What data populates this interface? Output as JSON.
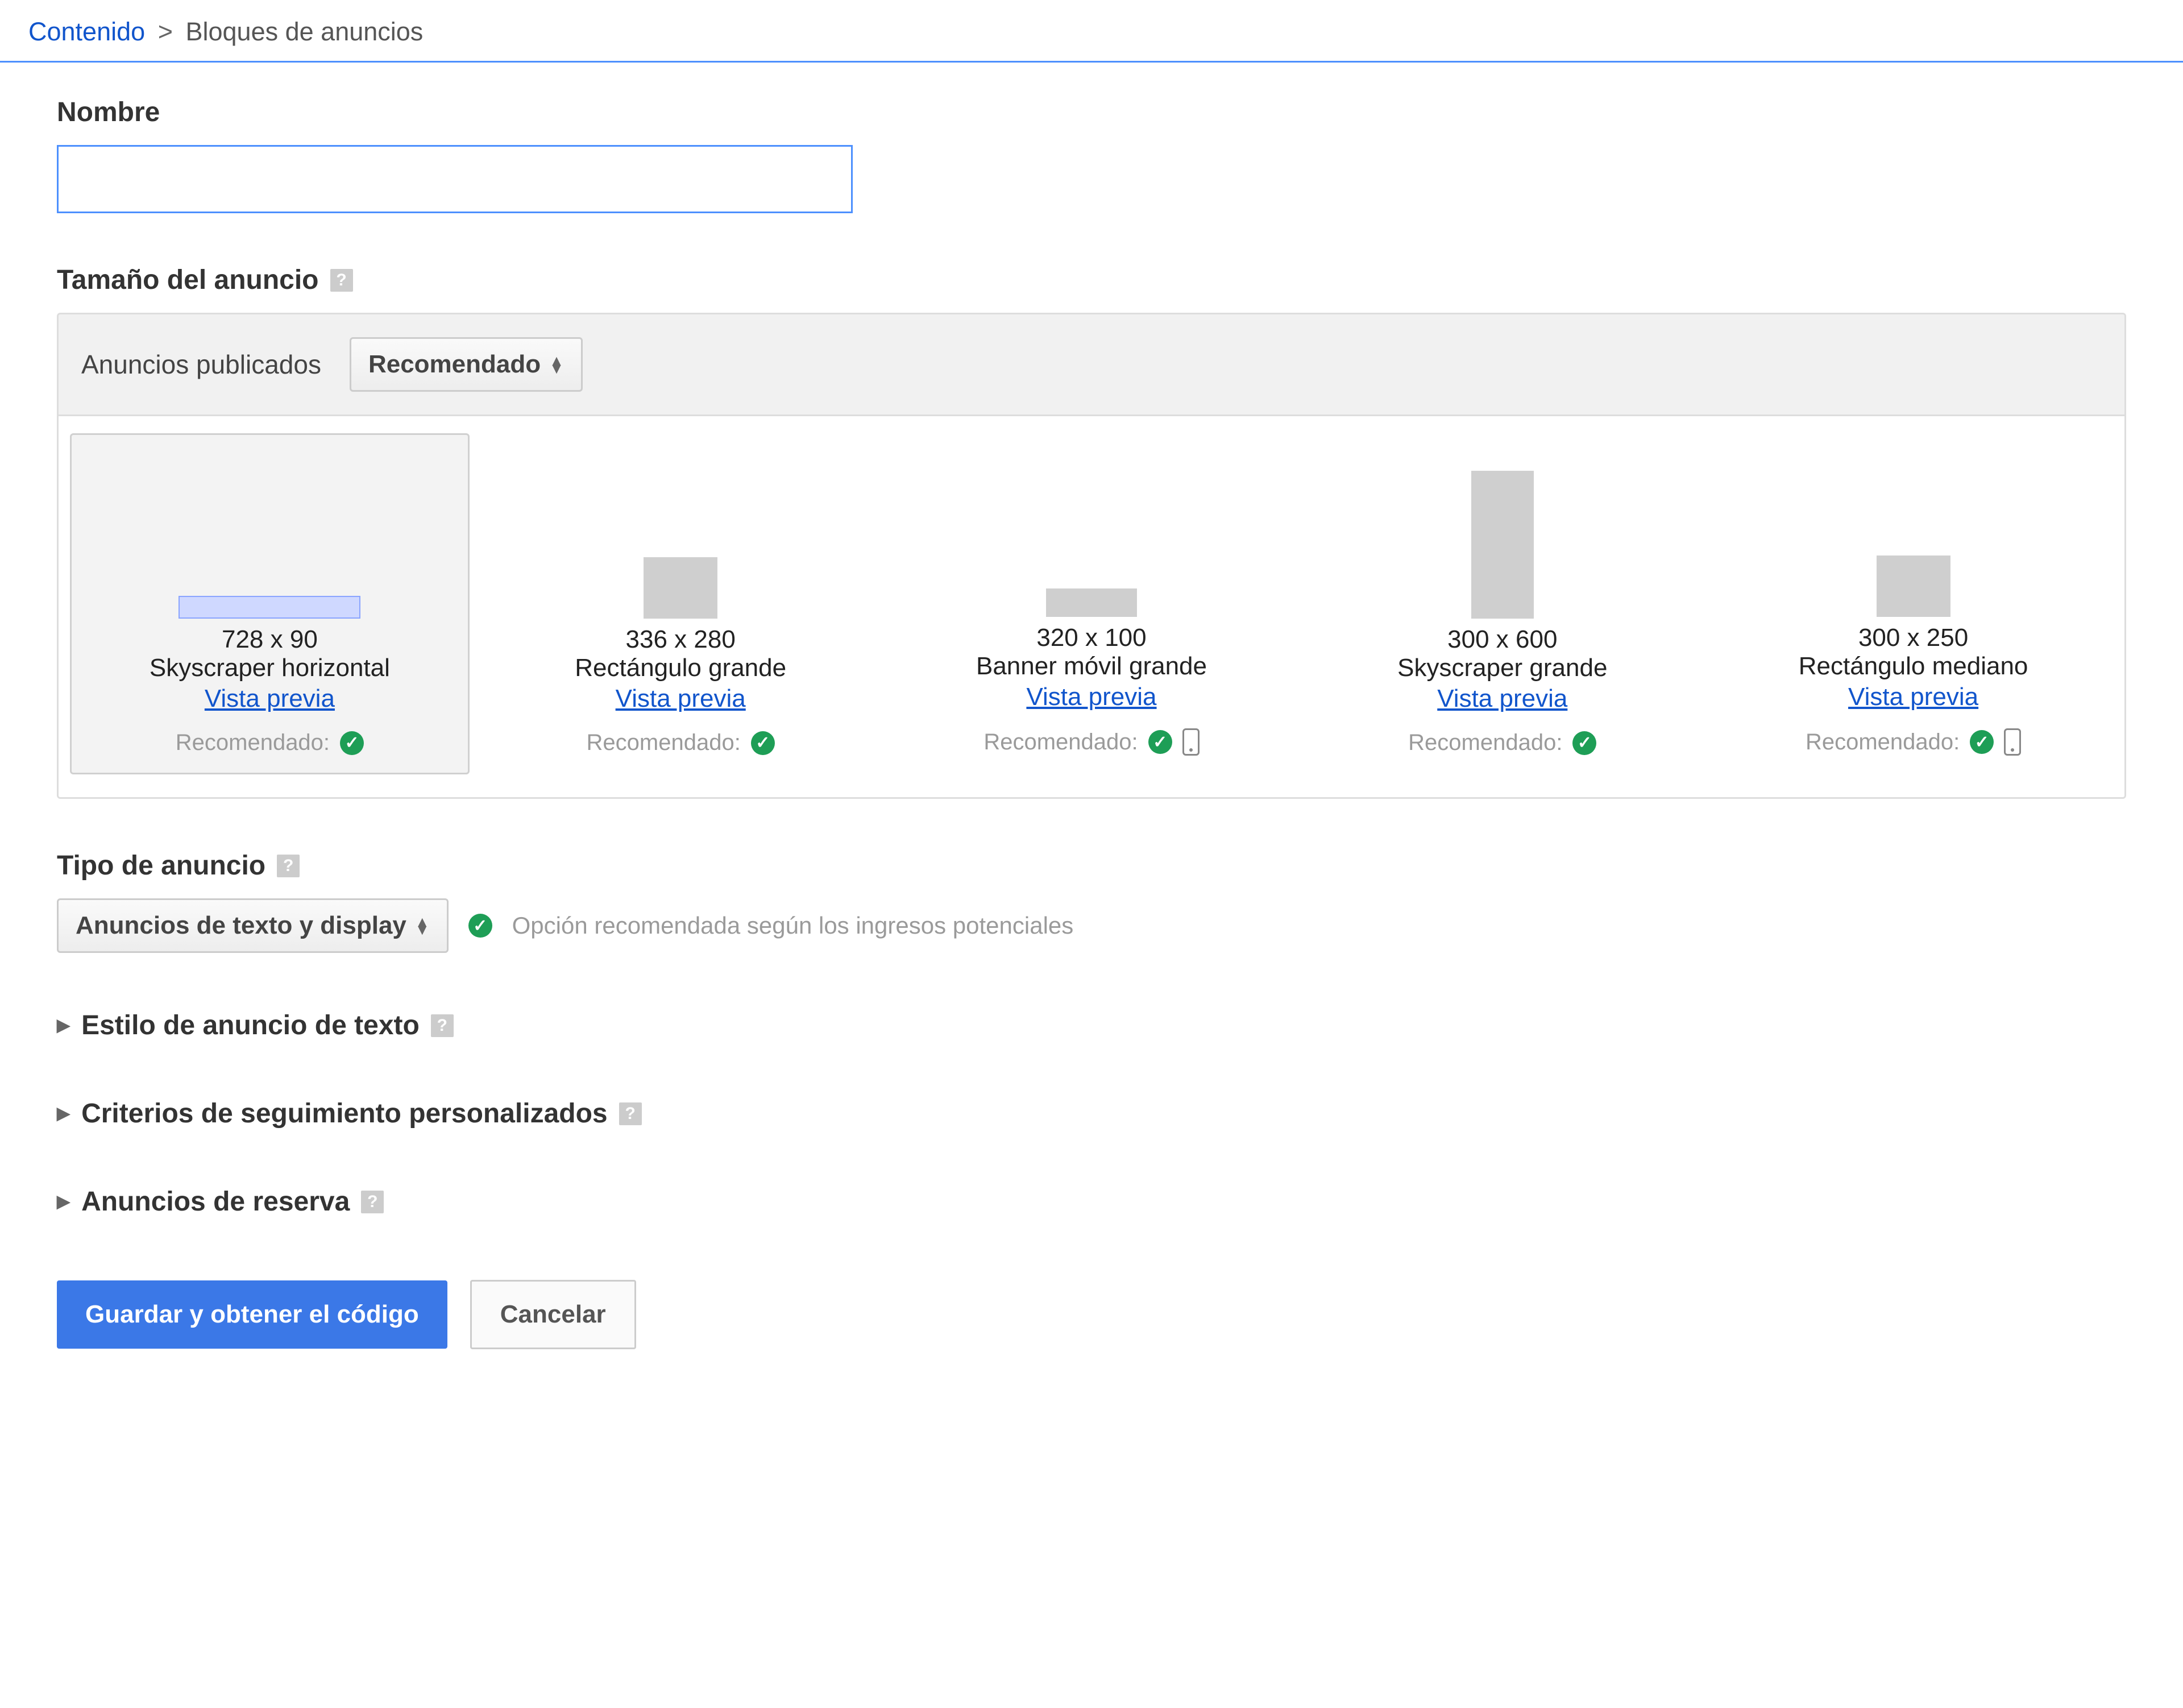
{
  "breadcrumb": {
    "root": "Contenido",
    "sep": ">",
    "current": "Bloques de anuncios"
  },
  "name": {
    "label": "Nombre",
    "value": ""
  },
  "adsize": {
    "label": "Tamaño del anuncio",
    "published_label": "Anuncios publicados",
    "filter_selected": "Recomendado",
    "preview_label": "Vista previa",
    "recommended_label": "Recomendado:",
    "cards": [
      {
        "dim": "728 x 90",
        "name": "Skyscraper horizontal",
        "selected": true,
        "mobile": false
      },
      {
        "dim": "336 x 280",
        "name": "Rectángulo grande",
        "selected": false,
        "mobile": false
      },
      {
        "dim": "320 x 100",
        "name": "Banner móvil grande",
        "selected": false,
        "mobile": true
      },
      {
        "dim": "300 x 600",
        "name": "Skyscraper grande",
        "selected": false,
        "mobile": false
      },
      {
        "dim": "300 x 250",
        "name": "Rectángulo mediano",
        "selected": false,
        "mobile": true
      }
    ]
  },
  "adtype": {
    "label": "Tipo de anuncio",
    "selected": "Anuncios de texto y display",
    "reco_note": "Opción recomendada según los ingresos potenciales"
  },
  "sections": {
    "text_style": "Estilo de anuncio de texto",
    "custom_tracking": "Criterios de seguimiento personalizados",
    "backup_ads": "Anuncios de reserva"
  },
  "actions": {
    "save": "Guardar y obtener el código",
    "cancel": "Cancelar"
  }
}
